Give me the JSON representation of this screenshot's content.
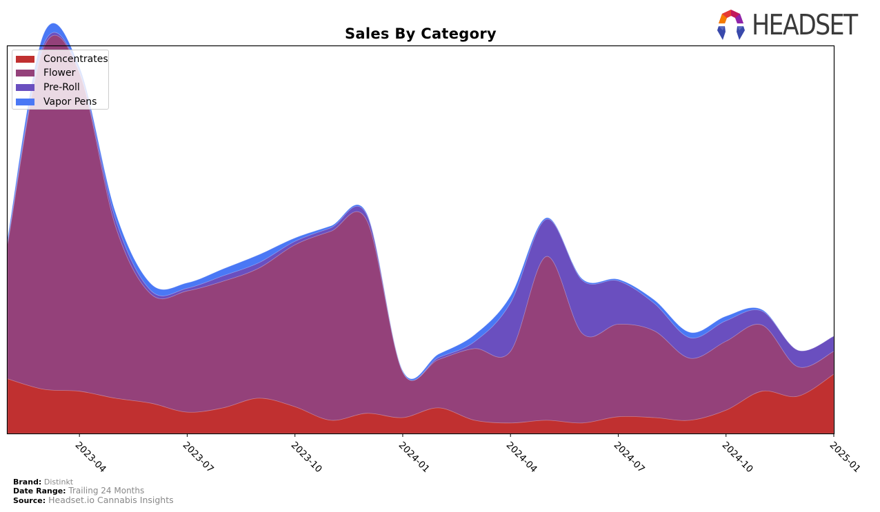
{
  "chart_data": {
    "type": "area",
    "stacked": true,
    "title": "Sales By Category",
    "xlabel": "",
    "ylabel": "",
    "yaxis_visible": false,
    "x": [
      "2023-02",
      "2023-03",
      "2023-04",
      "2023-05",
      "2023-06",
      "2023-07",
      "2023-08",
      "2023-09",
      "2023-10",
      "2023-11",
      "2023-12",
      "2024-01",
      "2024-02",
      "2024-03",
      "2024-04",
      "2024-05",
      "2024-06",
      "2024-07",
      "2024-08",
      "2024-09",
      "2024-10",
      "2024-11",
      "2024-12",
      "2025-01"
    ],
    "x_tick_labels": [
      "2023-04",
      "2023-07",
      "2023-10",
      "2024-01",
      "2024-04",
      "2024-07",
      "2024-10",
      "2025-01"
    ],
    "units": "relative (0-100 = full plot height)",
    "ylim": [
      0,
      100
    ],
    "series": [
      {
        "name": "Concentrates",
        "color": "#c03030",
        "values": [
          14.1,
          11.4,
          10.9,
          9.1,
          7.8,
          5.5,
          6.6,
          9.1,
          6.9,
          3.4,
          5.2,
          4.1,
          6.6,
          3.4,
          2.7,
          3.4,
          2.7,
          4.3,
          4.1,
          3.4,
          6.0,
          10.9,
          9.6,
          15.3
        ]
      },
      {
        "name": "Flower",
        "color": "#94417a",
        "values": [
          34.7,
          88.1,
          82.2,
          44.5,
          28.1,
          31.3,
          32.7,
          33.6,
          41.8,
          48.8,
          49.8,
          11.7,
          12.5,
          18.5,
          18.5,
          42.3,
          23.1,
          23.9,
          22.4,
          16.0,
          17.8,
          17.1,
          7.6,
          5.9
        ]
      },
      {
        "name": "Pre-Roll",
        "color": "#6a4fbf",
        "values": [
          0.5,
          0.9,
          0.4,
          1.8,
          0.9,
          0.7,
          1.4,
          1.4,
          0.9,
          0.9,
          1.4,
          0.0,
          0.5,
          1.8,
          12.5,
          9.6,
          13.7,
          11.2,
          7.1,
          5.3,
          5.3,
          3.6,
          4.3,
          3.9
        ]
      },
      {
        "name": "Vapor Pens",
        "color": "#4a78f5",
        "values": [
          1.2,
          2.7,
          1.1,
          1.8,
          1.8,
          1.4,
          1.8,
          2.1,
          0.9,
          0.5,
          0.4,
          0.4,
          0.9,
          1.8,
          1.8,
          0.4,
          0.4,
          0.4,
          0.9,
          1.4,
          1.2,
          0.4,
          0.0,
          0.0
        ]
      }
    ],
    "legend": {
      "position": "top-left",
      "entries": [
        "Concentrates",
        "Flower",
        "Pre-Roll",
        "Vapor Pens"
      ]
    },
    "grid": false
  },
  "logo": {
    "text": "HEADSET"
  },
  "footer": {
    "brand_label": "Brand:",
    "brand_value": "Distinkt",
    "date_range_label": "Date Range:",
    "date_range_value": "Trailing 24 Months",
    "source_label": "Source:",
    "source_value": "Headset.io Cannabis Insights"
  }
}
